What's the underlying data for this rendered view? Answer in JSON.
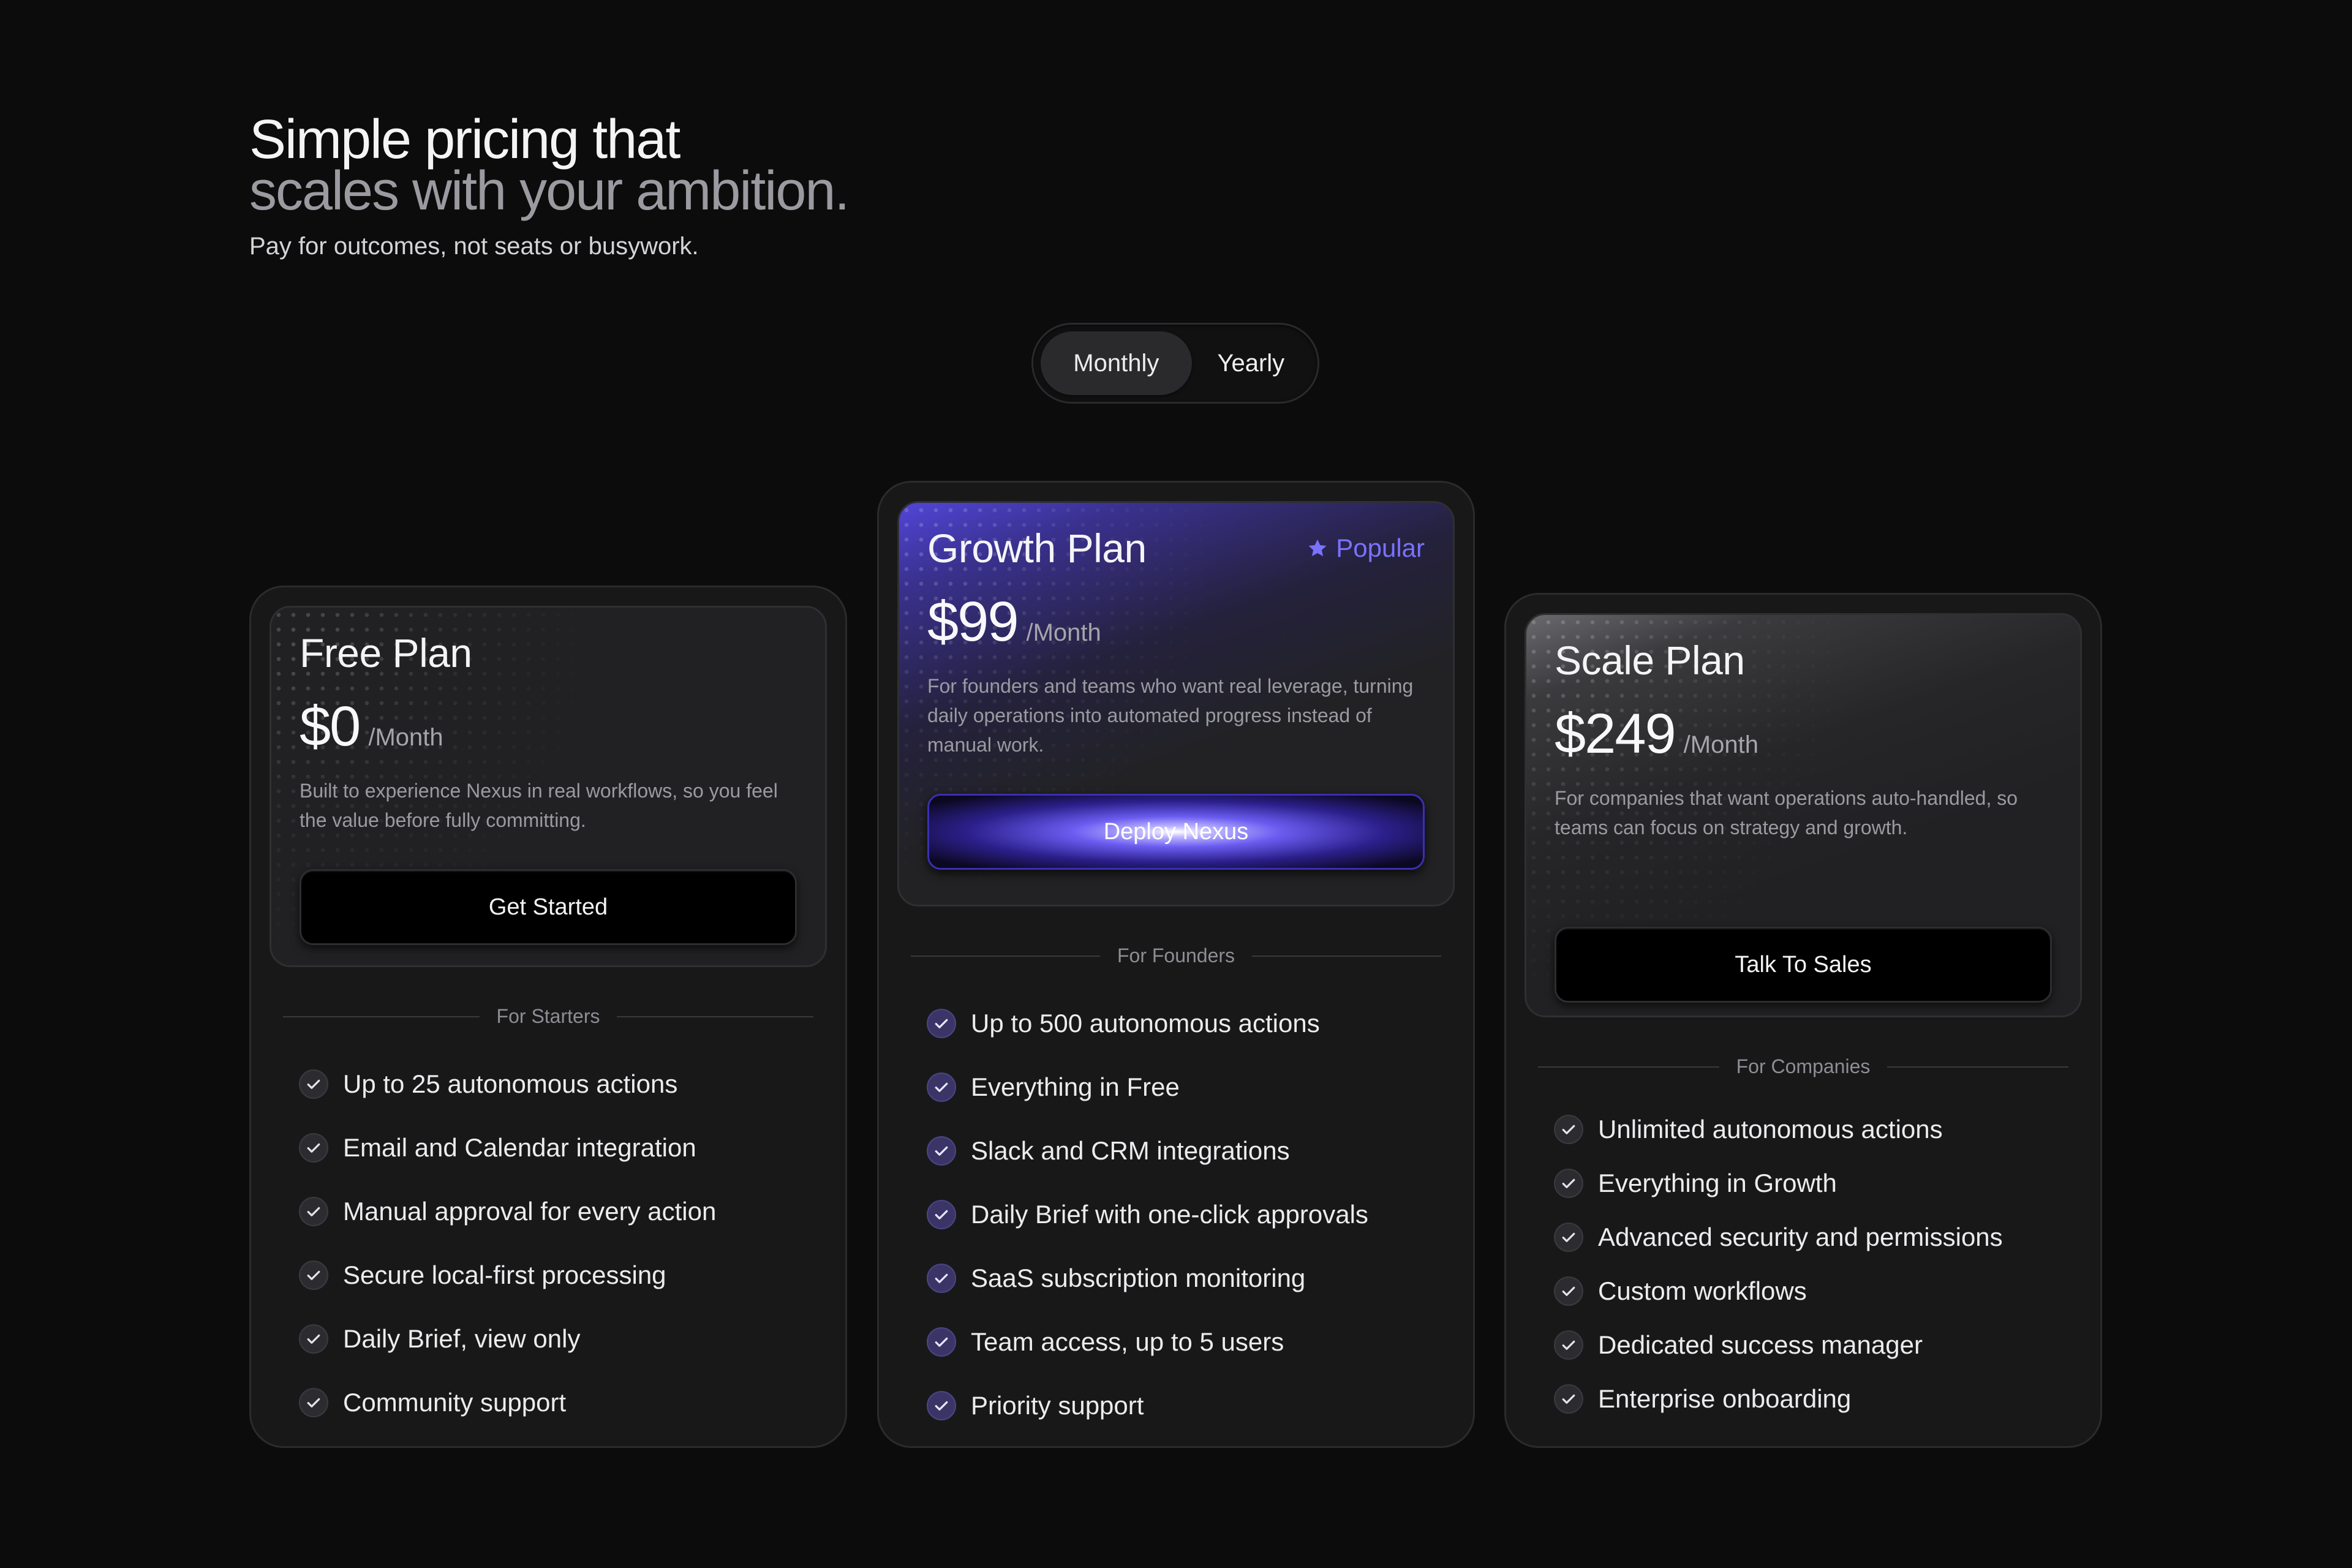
{
  "hero": {
    "title_line1": "Simple pricing that",
    "title_line2": "scales with your ambition.",
    "subtitle": "Pay for outcomes, not seats or busywork."
  },
  "billing_toggle": {
    "options": [
      "Monthly",
      "Yearly"
    ],
    "selected": "Monthly"
  },
  "plans": [
    {
      "name": "Free Plan",
      "price": "$0",
      "period": "/Month",
      "description": "Built to experience Nexus in real workflows, so you feel the value before fully committing.",
      "cta": "Get Started",
      "audience": "For Starters",
      "features": [
        "Up to 25 autonomous actions",
        "Email and Calendar integration",
        "Manual approval for every action",
        "Secure local-first processing",
        "Daily Brief, view only",
        "Community support"
      ]
    },
    {
      "name": "Growth Plan",
      "badge": "Popular",
      "price": "$99",
      "period": "/Month",
      "description": "For founders and teams who want real leverage, turning daily operations into automated progress instead of manual work.",
      "cta": "Deploy Nexus",
      "audience": "For Founders",
      "features": [
        "Up to 500 autonomous actions",
        "Everything in Free",
        "Slack and CRM integrations",
        "Daily Brief with one-click approvals",
        "SaaS subscription monitoring",
        "Team access, up to 5 users",
        "Priority support"
      ]
    },
    {
      "name": "Scale Plan",
      "price": "$249",
      "period": "/Month",
      "description": "For companies that want operations auto-handled, so teams can focus on strategy and growth.",
      "cta": "Talk To Sales",
      "audience": "For Companies",
      "features": [
        "Unlimited autonomous actions",
        "Everything in Growth",
        "Advanced security and permissions",
        "Custom workflows",
        "Dedicated success manager",
        "Enterprise onboarding"
      ]
    }
  ],
  "colors": {
    "background": "#0c0c0d",
    "accent": "#7a72ff",
    "card": "#181819"
  },
  "icons": [
    "star-icon",
    "check-icon"
  ]
}
